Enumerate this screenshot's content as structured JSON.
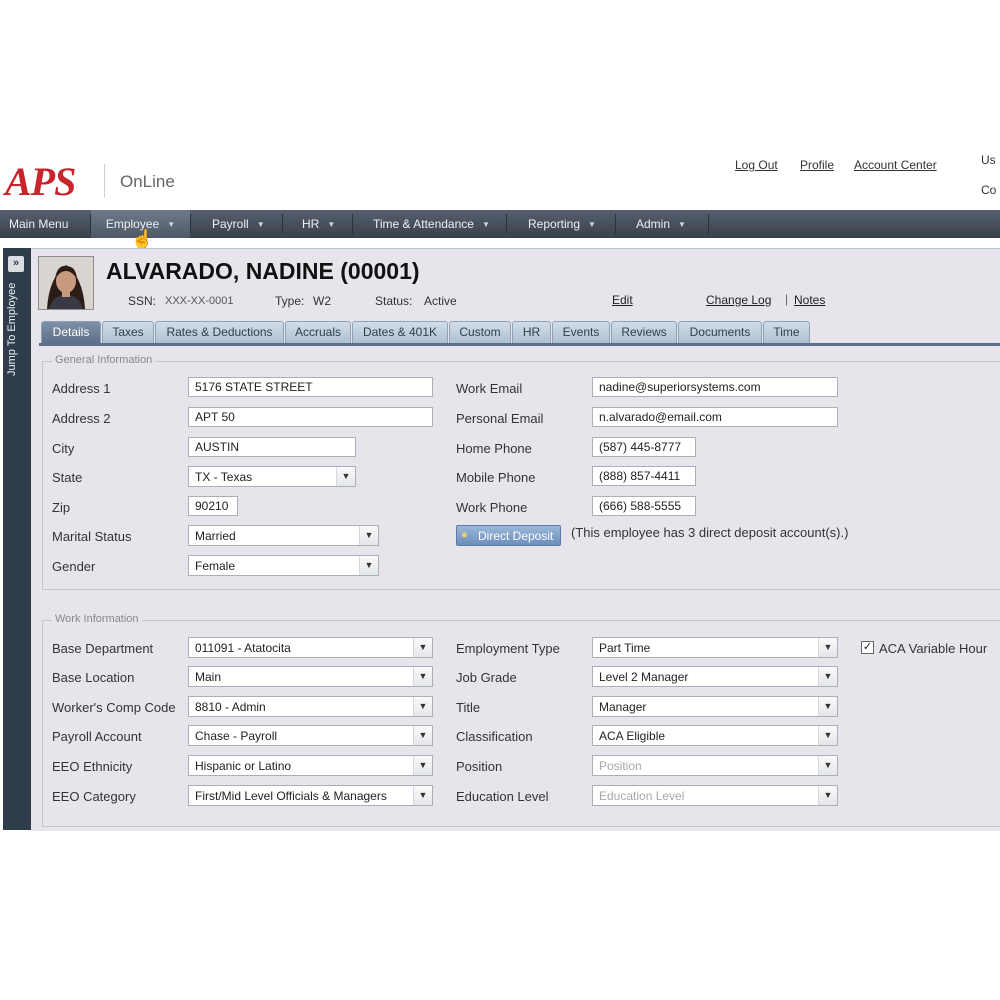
{
  "header": {
    "logo": "APS",
    "product": "OnLine",
    "links": [
      "Log Out",
      "Profile",
      "Account Center"
    ],
    "trunc_top": "Us",
    "trunc_bottom": "Co"
  },
  "menu": {
    "items": [
      {
        "label": "Main Menu",
        "caret": false
      },
      {
        "label": "Employee",
        "caret": true,
        "active": true
      },
      {
        "label": "Payroll",
        "caret": true
      },
      {
        "label": "HR",
        "caret": true
      },
      {
        "label": "Time & Attendance",
        "caret": true
      },
      {
        "label": "Reporting",
        "caret": true
      },
      {
        "label": "Admin",
        "caret": true
      }
    ]
  },
  "sidebar": {
    "jump_label": "Jump To Employee",
    "jump_icon": "double-chevron-right-icon"
  },
  "employee": {
    "name": "ALVARADO, NADINE (00001)",
    "ssn_label": "SSN:",
    "ssn": "XXX-XX-0001",
    "type_label": "Type:",
    "type": "W2",
    "status_label": "Status:",
    "status": "Active",
    "edit_link": "Edit",
    "change_log_link": "Change Log",
    "link_separator": "|",
    "notes_link": "Notes"
  },
  "tabs": [
    "Details",
    "Taxes",
    "Rates & Deductions",
    "Accruals",
    "Dates & 401K",
    "Custom",
    "HR",
    "Events",
    "Reviews",
    "Documents",
    "Time"
  ],
  "active_tab": "Details",
  "general": {
    "legend": "General Information",
    "labels": {
      "address1": "Address 1",
      "address2": "Address 2",
      "city": "City",
      "state": "State",
      "zip": "Zip",
      "marital": "Marital Status",
      "gender": "Gender",
      "work_email": "Work Email",
      "personal_email": "Personal Email",
      "home_phone": "Home Phone",
      "mobile_phone": "Mobile Phone",
      "work_phone": "Work Phone"
    },
    "values": {
      "address1": "5176 STATE STREET",
      "address2": "APT 50",
      "city": "AUSTIN",
      "state": "TX - Texas",
      "zip": "90210",
      "marital": "Married",
      "gender": "Female",
      "work_email": "nadine@superiorsystems.com",
      "personal_email": "n.alvarado@email.com",
      "home_phone": "(587) 445-8777",
      "mobile_phone": "(888) 857-4411",
      "work_phone": "(666) 588-5555"
    },
    "direct_deposit_button": "Direct Deposit",
    "direct_deposit_note": "(This employee has 3 direct deposit account(s).)"
  },
  "work": {
    "legend": "Work Information",
    "labels": {
      "base_department": "Base Department",
      "base_location": "Base Location",
      "comp_code": "Worker's Comp Code",
      "payroll_account": "Payroll Account",
      "eeo_ethnicity": "EEO Ethnicity",
      "eeo_category": "EEO Category",
      "employment_type": "Employment Type",
      "job_grade": "Job Grade",
      "title": "Title",
      "classification": "Classification",
      "position": "Position",
      "education_level": "Education Level"
    },
    "values": {
      "base_department": "011091 - Atatocita",
      "base_location": "Main",
      "comp_code": "8810 - Admin",
      "payroll_account": "Chase - Payroll",
      "eeo_ethnicity": "Hispanic or Latino",
      "eeo_category": "First/Mid Level Officials & Managers",
      "employment_type": "Part Time",
      "job_grade": "Level 2 Manager",
      "title": "Manager",
      "classification": "ACA Eligible",
      "position": "Position",
      "education_level": "Education Level"
    },
    "aca_label": "ACA Variable Hour",
    "aca_checked": true
  }
}
